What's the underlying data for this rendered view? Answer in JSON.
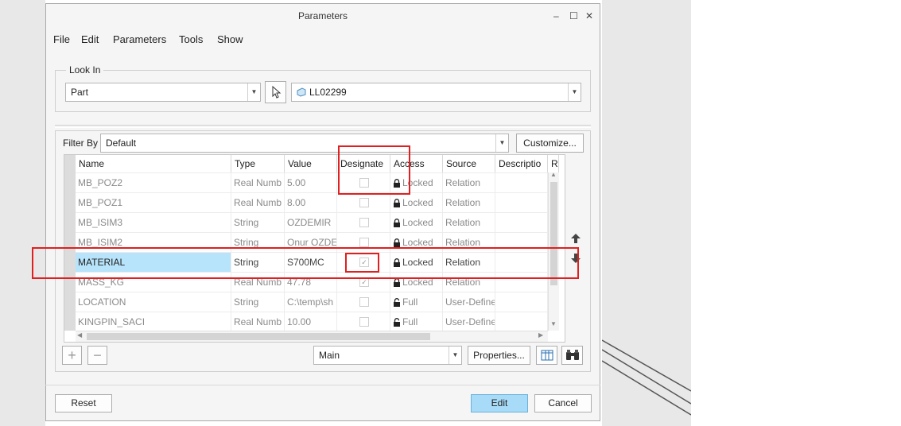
{
  "window": {
    "title": "Parameters",
    "controls": [
      "‒",
      "☐",
      "✕"
    ]
  },
  "menu": [
    "File",
    "Edit",
    "Parameters",
    "Tools",
    "Show"
  ],
  "look_in": {
    "legend": "Look In",
    "type_value": "Part",
    "model_value": "LL02299"
  },
  "filter": {
    "label": "Filter By",
    "value": "Default",
    "customize_label": "Customize..."
  },
  "table": {
    "columns": [
      "Name",
      "Type",
      "Value",
      "Designate",
      "Access",
      "Source",
      "Descriptio",
      "Re"
    ],
    "rows": [
      {
        "name": "MB_POZ2",
        "type": "Real Numb",
        "value": "5.00",
        "designated": false,
        "access": "Locked",
        "source": "Relation"
      },
      {
        "name": "MB_POZ1",
        "type": "Real Numb",
        "value": "8.00",
        "designated": false,
        "access": "Locked",
        "source": "Relation"
      },
      {
        "name": "MB_ISIM3",
        "type": "String",
        "value": "OZDEMIR",
        "designated": false,
        "access": "Locked",
        "source": "Relation"
      },
      {
        "name": "MB_ISIM2",
        "type": "String",
        "value": "Onur OZDE",
        "designated": false,
        "access": "Locked",
        "source": "Relation"
      },
      {
        "name": "MATERIAL",
        "type": "String",
        "value": "S700MC",
        "designated": true,
        "access": "Locked",
        "source": "Relation"
      },
      {
        "name": "MASS_KG",
        "type": "Real Numb",
        "value": "47.78",
        "designated": true,
        "access": "Locked",
        "source": "Relation"
      },
      {
        "name": "LOCATION",
        "type": "String",
        "value": "C:\\temp\\sh",
        "designated": false,
        "access": "Full",
        "source": "User-Define"
      },
      {
        "name": "KINGPIN_SACI",
        "type": "Real Numb",
        "value": "10.00",
        "designated": false,
        "access": "Full",
        "source": "User-Define"
      }
    ]
  },
  "bottom_bar": {
    "view_value": "Main",
    "properties_label": "Properties...",
    "add": "+",
    "remove": "−"
  },
  "footer": {
    "reset_label": "Reset",
    "edit_label": "Edit",
    "cancel_label": "Cancel"
  },
  "colors": {
    "highlight": "#e02020",
    "selection": "#b8e4fb",
    "primary_button": "#a8dbf7"
  }
}
